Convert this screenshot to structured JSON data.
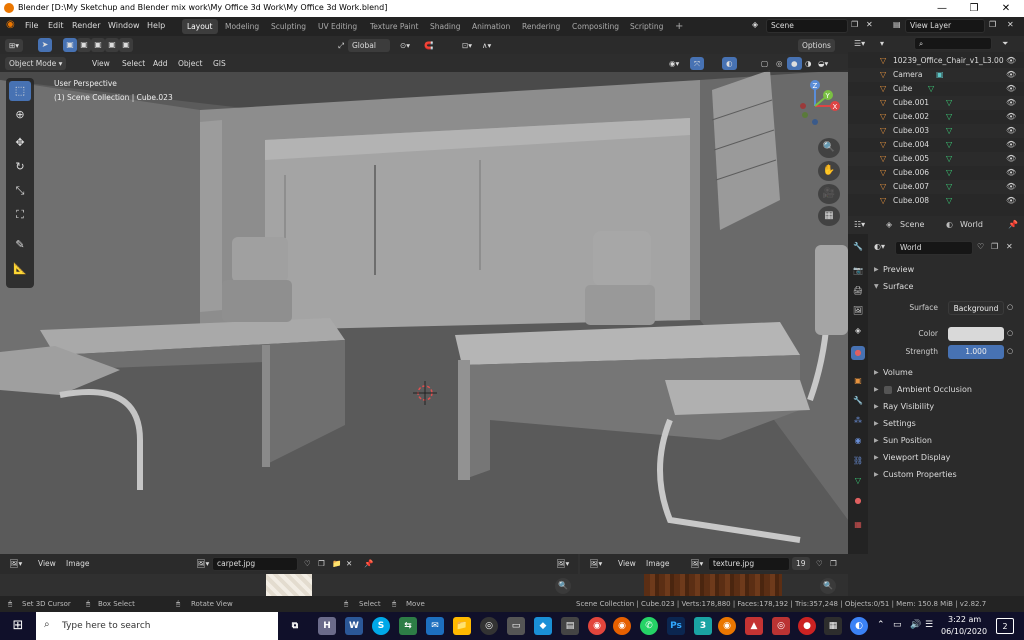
{
  "window": {
    "title": "Blender [D:\\My Sketchup and Blender mix work\\My Office 3d Work\\My Office 3d Work.blend]",
    "minimize": "—",
    "maximize": "❐",
    "close": "✕"
  },
  "menu": [
    "File",
    "Edit",
    "Render",
    "Window",
    "Help"
  ],
  "workspaces": [
    "Layout",
    "Modeling",
    "Sculpting",
    "UV Editing",
    "Texture Paint",
    "Shading",
    "Animation",
    "Rendering",
    "Compositing",
    "Scripting"
  ],
  "active_workspace": "Layout",
  "add_workspace": "+",
  "scene_field": "Scene",
  "view_layer_field": "View Layer",
  "viewport": {
    "mode": "Object Mode",
    "menus": [
      "View",
      "Select",
      "Add",
      "Object",
      "GIS"
    ],
    "transform_orientation": "Global",
    "options": "Options",
    "perspective": "User Perspective",
    "collection_info": "(1) Scene Collection | Cube.023"
  },
  "gizmo": {
    "x": "X",
    "y": "Y",
    "z": "Z"
  },
  "outliner": {
    "items": [
      {
        "name": "10239_Office_Chair_v1_L3.00",
        "type": "mesh-data"
      },
      {
        "name": "Camera",
        "type": "camera"
      },
      {
        "name": "Cube",
        "type": "mesh"
      },
      {
        "name": "Cube.001",
        "type": "mesh"
      },
      {
        "name": "Cube.002",
        "type": "mesh"
      },
      {
        "name": "Cube.003",
        "type": "mesh"
      },
      {
        "name": "Cube.004",
        "type": "mesh"
      },
      {
        "name": "Cube.005",
        "type": "mesh"
      },
      {
        "name": "Cube.006",
        "type": "mesh"
      },
      {
        "name": "Cube.007",
        "type": "mesh"
      },
      {
        "name": "Cube.008",
        "type": "mesh"
      }
    ]
  },
  "properties": {
    "breadcrumb_scene": "Scene",
    "breadcrumb_world": "World",
    "world_name": "World",
    "panels": {
      "preview": "Preview",
      "surface": "Surface",
      "volume": "Volume",
      "ambient_occlusion": "Ambient Occlusion",
      "ray_visibility": "Ray Visibility",
      "settings": "Settings",
      "sun_position": "Sun Position",
      "viewport_display": "Viewport Display",
      "custom_properties": "Custom Properties"
    },
    "surface_label": "Surface",
    "surface_value": "Background",
    "color_label": "Color",
    "color_value": "#d9d9d9",
    "strength_label": "Strength",
    "strength_value": "1.000"
  },
  "image_editor_left": {
    "menus": [
      "View",
      "Image"
    ],
    "image": "carpet.jpg"
  },
  "image_editor_right": {
    "menus": [
      "View",
      "Image"
    ],
    "image": "texture.jpg",
    "users": "19"
  },
  "status": {
    "left1": "Set 3D Cursor",
    "left2": "Box Select",
    "left3": "Rotate View",
    "mid1": "Select",
    "mid2": "Move",
    "stats": "Scene Collection | Cube.023 | Verts:178,880 | Faces:178,192 | Tris:357,248 | Objects:0/51 | Mem: 150.8 MiB | v2.82.7"
  },
  "taskbar": {
    "search_placeholder": "Type here to search",
    "time": "3:22 am",
    "date": "06/10/2020",
    "notifications": "2"
  },
  "colors": {
    "accent": "#4772b3",
    "blender_orange": "#ea7600",
    "mesh_green": "#3dcf7a",
    "object_orange": "#e6933f"
  }
}
